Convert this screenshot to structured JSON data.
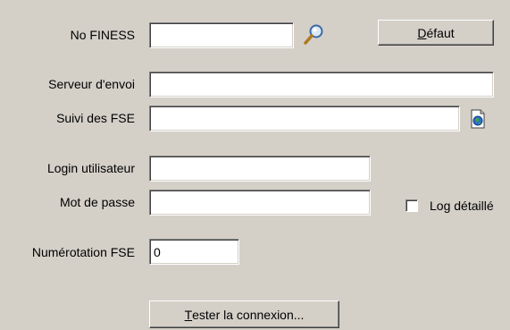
{
  "fields": {
    "finess_label": "No FINESS",
    "finess_value": "",
    "serveur_label": "Serveur d'envoi",
    "serveur_value": "",
    "suivi_label": "Suivi des FSE",
    "suivi_value": "",
    "login_label": "Login utilisateur",
    "login_value": "",
    "password_label": "Mot de passe",
    "password_value": "",
    "numerotation_label": "Numérotation FSE",
    "numerotation_value": "0"
  },
  "buttons": {
    "defaut_first": "D",
    "defaut_rest": "éfaut",
    "tester_first": "T",
    "tester_rest": "ester la connexion..."
  },
  "checkbox": {
    "log_label": "Log détaillé",
    "log_checked": false
  },
  "icons": {
    "search": "magnifier-icon",
    "browse": "globe-document-icon"
  }
}
